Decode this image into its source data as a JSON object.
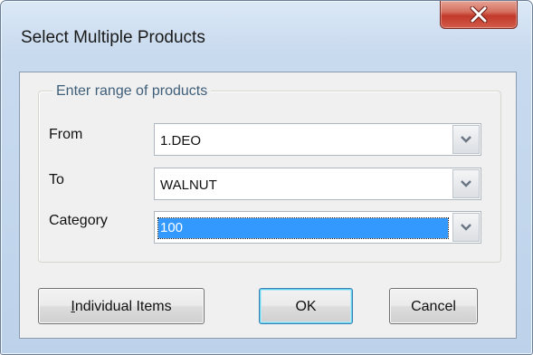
{
  "window": {
    "title": "Select Multiple Products"
  },
  "group": {
    "legend": "Enter range of products"
  },
  "fields": {
    "from": {
      "label": "From",
      "value": "1.DEO"
    },
    "to": {
      "label": "To",
      "value": "WALNUT"
    },
    "category": {
      "label": "Category",
      "value": "100"
    }
  },
  "buttons": {
    "individual_mnemonic": "I",
    "individual_rest": "ndividual Items",
    "ok": "OK",
    "cancel": "Cancel"
  },
  "icons": {
    "close": "close-icon",
    "dropdown": "chevron-down-icon"
  },
  "colors": {
    "selection": "#3399ff",
    "close_button": "#c2392a",
    "legend_text": "#3f5f7a"
  }
}
